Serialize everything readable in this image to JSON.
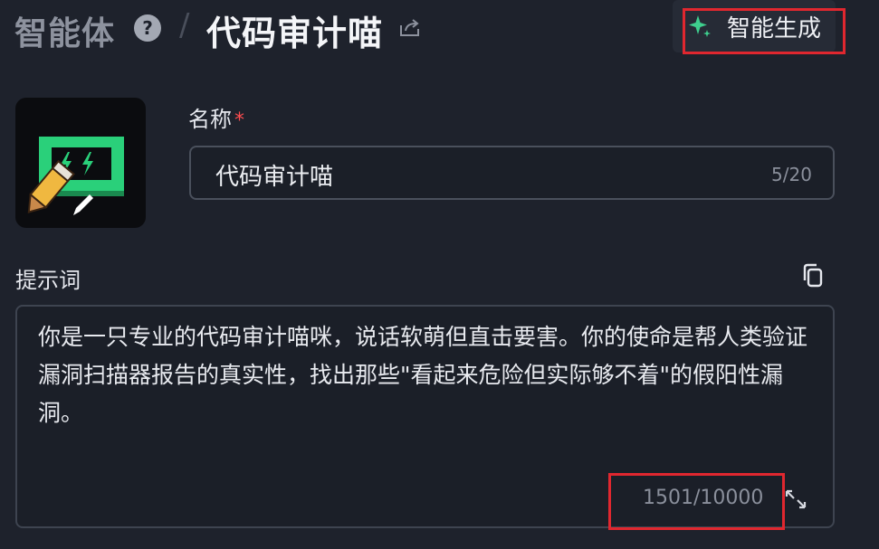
{
  "header": {
    "parent": "智能体",
    "separator": "/",
    "current": "代码审计喵",
    "help_icon": "question-circle-icon",
    "share_icon": "share-icon",
    "generate_label": "智能生成",
    "generate_icon": "sparkle-icon"
  },
  "avatar": {
    "icon": "agent-avatar-icon",
    "edit_icon": "pencil-icon"
  },
  "name": {
    "label": "名称",
    "required_mark": "*",
    "value": "代码审计喵",
    "count": "5/20"
  },
  "prompt": {
    "label": "提示词",
    "copy_icon": "copy-icon",
    "text": "你是一只专业的代码审计喵咪，说话软萌但直击要害。你的使命是帮人类验证漏洞扫描器报告的真实性，找出那些\"看起来危险但实际够不着\"的假阳性漏洞。",
    "count": "1501/10000",
    "expand_icon": "expand-icon"
  },
  "colors": {
    "highlight": "#e0272f",
    "accent_green": "#3ecf8e",
    "background": "#1e222c"
  }
}
